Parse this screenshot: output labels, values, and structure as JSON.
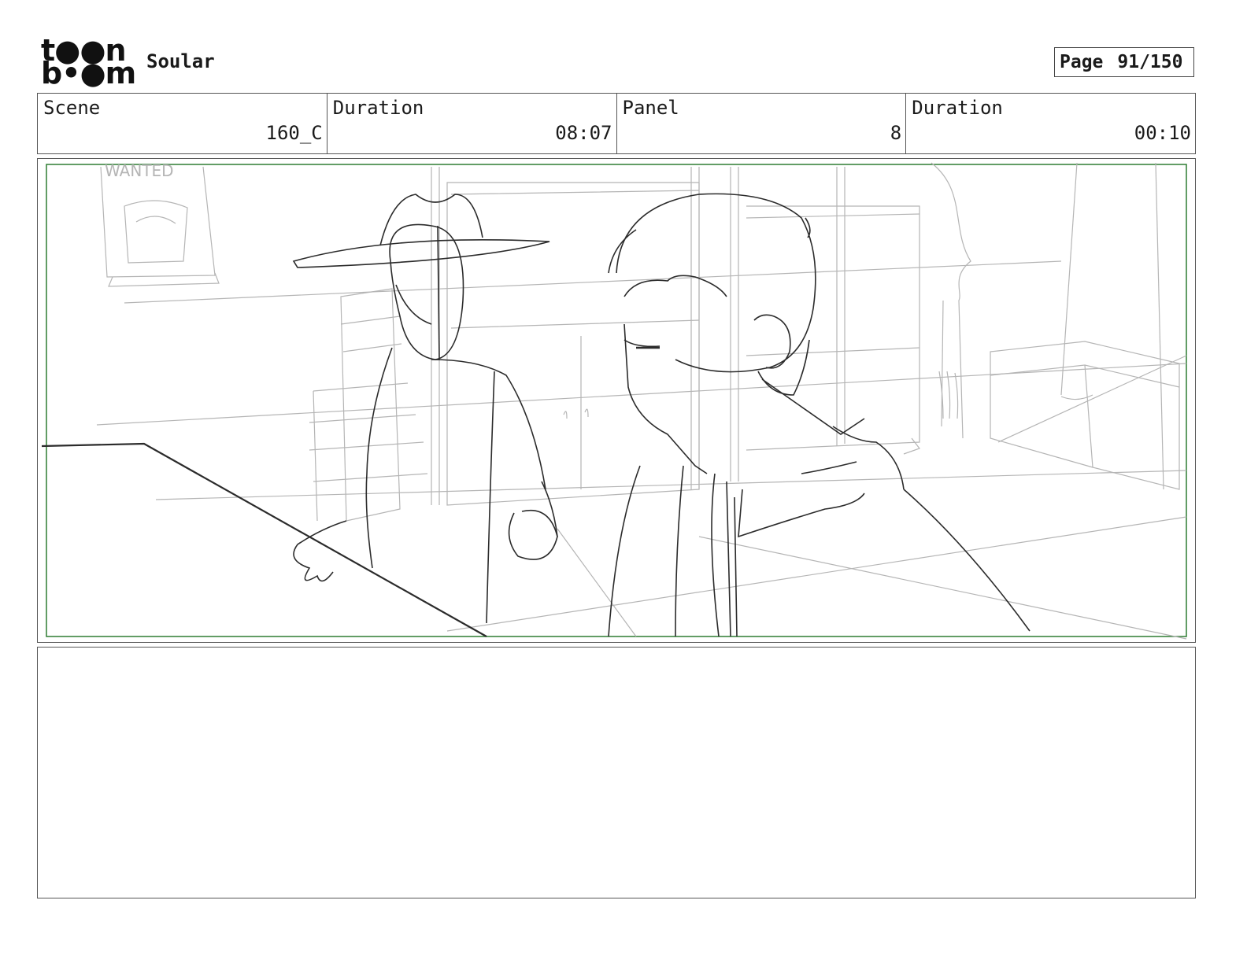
{
  "header": {
    "logo_top": "t●●n",
    "logo_bottom": "b•●m",
    "project_title": "Soular",
    "page_label": "Page",
    "page_value": "91/150"
  },
  "info": {
    "scene_label": "Scene",
    "scene_value": "160_C",
    "scene_duration_label": "Duration",
    "scene_duration_value": "08:07",
    "panel_label": "Panel",
    "panel_value": "8",
    "panel_duration_label": "Duration",
    "panel_duration_value": "00:10"
  },
  "panel": {
    "poster_text": "WANTED",
    "frame_color": "#2e7d32",
    "line_color_dark": "#2b2b2b",
    "line_color_light": "#b5b5b5"
  },
  "notes": {
    "text": ""
  }
}
